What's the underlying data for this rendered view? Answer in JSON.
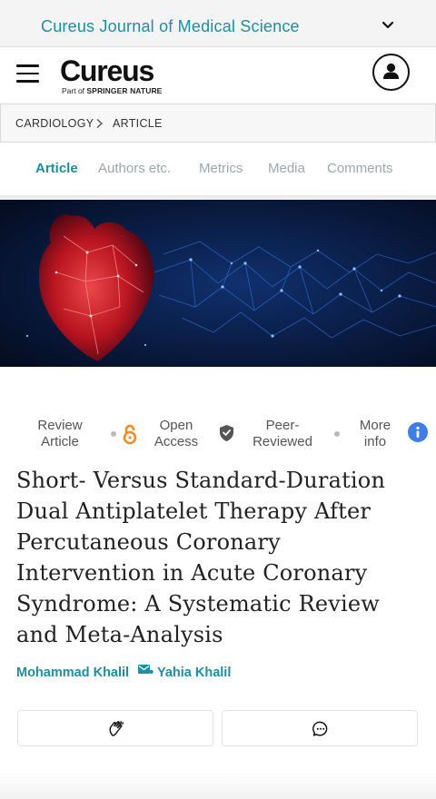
{
  "journal_bar": {
    "title": "Cureus Journal of Medical Science",
    "chevron_icon": "chevron-down-icon"
  },
  "header": {
    "menu_icon": "hamburger-icon",
    "logo_text": "Cureus",
    "logo_sub_prefix": "Part of ",
    "logo_sub_brand": "SPRINGER NATURE",
    "user_icon": "user-icon"
  },
  "breadcrumb": {
    "items": [
      "CARDIOLOGY",
      "ARTICLE"
    ],
    "separator_icon": "chevron-right-icon"
  },
  "tabs": [
    "Article",
    "Authors etc.",
    "Metrics",
    "Media",
    "Comments"
  ],
  "active_tab": "Article",
  "badges": {
    "type_line1": "Review",
    "type_line2": "Article",
    "access_line1": "Open",
    "access_line2": "Access",
    "review_line1": "Peer-",
    "review_line2": "Reviewed",
    "more_line1": "More",
    "more_line2": "info",
    "icons": [
      "open-access-icon",
      "shield-check-icon",
      "info-icon"
    ]
  },
  "article": {
    "title": "Short- Versus Standard-Duration Dual Antiplatelet Therapy After Percutaneous Coronary Intervention in Acute Coronary Syndrome: A Systematic Review and Meta-Analysis",
    "author_1": "Mohammad Khalil",
    "author_separator": " • ",
    "author_2": "Yahia Khalil"
  },
  "actions": {
    "icons": [
      "clap-icon",
      "comment-icon"
    ]
  },
  "colors": {
    "accent": "#1d8fa0",
    "open_access": "#f28c28",
    "info": "#3f7ee8",
    "text": "#222222",
    "tab_inactive": "#9aa8ad"
  }
}
